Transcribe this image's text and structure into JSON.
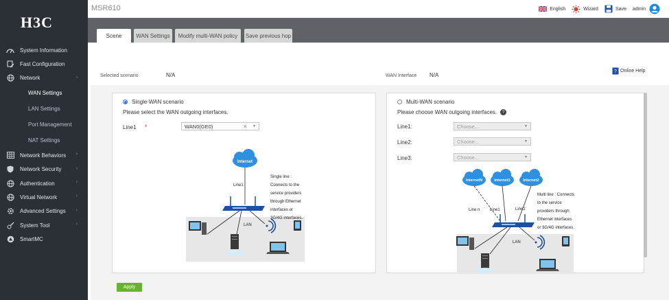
{
  "brand": {
    "logo": "H3C",
    "device": "MSR610"
  },
  "topbar": {
    "language": "English",
    "wizard": "Wizard",
    "save": "Save",
    "user": "admin"
  },
  "sidebar": {
    "items": [
      {
        "label": "System Information"
      },
      {
        "label": "Fast Configuration"
      },
      {
        "label": "Network"
      },
      {
        "label": "Network Behaviors"
      },
      {
        "label": "Network Security"
      },
      {
        "label": "Authentication"
      },
      {
        "label": "Virtual Network"
      },
      {
        "label": "Advanced Settings"
      },
      {
        "label": "System Tool"
      },
      {
        "label": "SmartMC"
      }
    ],
    "network_sub": [
      "WAN Settings",
      "LAN Settings",
      "Port Management",
      "NAT Settings"
    ]
  },
  "tabs": [
    "Scene",
    "WAN Settings",
    "Modify multi-WAN policy",
    "Save previous hop"
  ],
  "scene": {
    "selected_label": "Selected scenario",
    "selected_value": "N/A",
    "wan_label": "WAN Interface",
    "wan_value": "N/A",
    "help": "Online Help"
  },
  "single": {
    "title": "Single-WAN scenario",
    "prompt": "Please select the WAN outgoing interfaces.",
    "line1_label": "Line1",
    "required": "*",
    "line1_value": "WAN0(GE0)",
    "clear": "×",
    "diagram": {
      "cloud": "Internet",
      "line": "Line1",
      "lan": "LAN",
      "desc": [
        "Single line :",
        "Connects to the",
        "service providers",
        "through Ethernet",
        "interfaces or",
        "3G/4G interfaces."
      ]
    }
  },
  "multi": {
    "title": "Multi-WAN scenario",
    "prompt": "Please choose WAN outgoing interfaces.",
    "help_glyph": "?",
    "lines": [
      {
        "label": "Line1:",
        "placeholder": "Choose..."
      },
      {
        "label": "Line2:",
        "placeholder": "Choose..."
      },
      {
        "label": "Line3:",
        "placeholder": "Choose..."
      }
    ],
    "diagram": {
      "clouds": [
        "InternetN",
        "Internet1",
        "Internet2"
      ],
      "line_n": "Line n",
      "line1": "Line1",
      "line2": "Line2",
      "lan": "LAN",
      "desc": [
        "Multi line : Connects",
        "to the service",
        "providers through",
        "Ethernet interfaces",
        "or 3G/4G interfaces."
      ]
    }
  },
  "apply": "Apply",
  "colors": {
    "sidebar": "#2b3036",
    "tabbar": "#5f6266",
    "apply": "#66b32e",
    "accent": "#3a7bd5",
    "cloud": "#2f8fe0",
    "router": "#1f4fa0"
  }
}
